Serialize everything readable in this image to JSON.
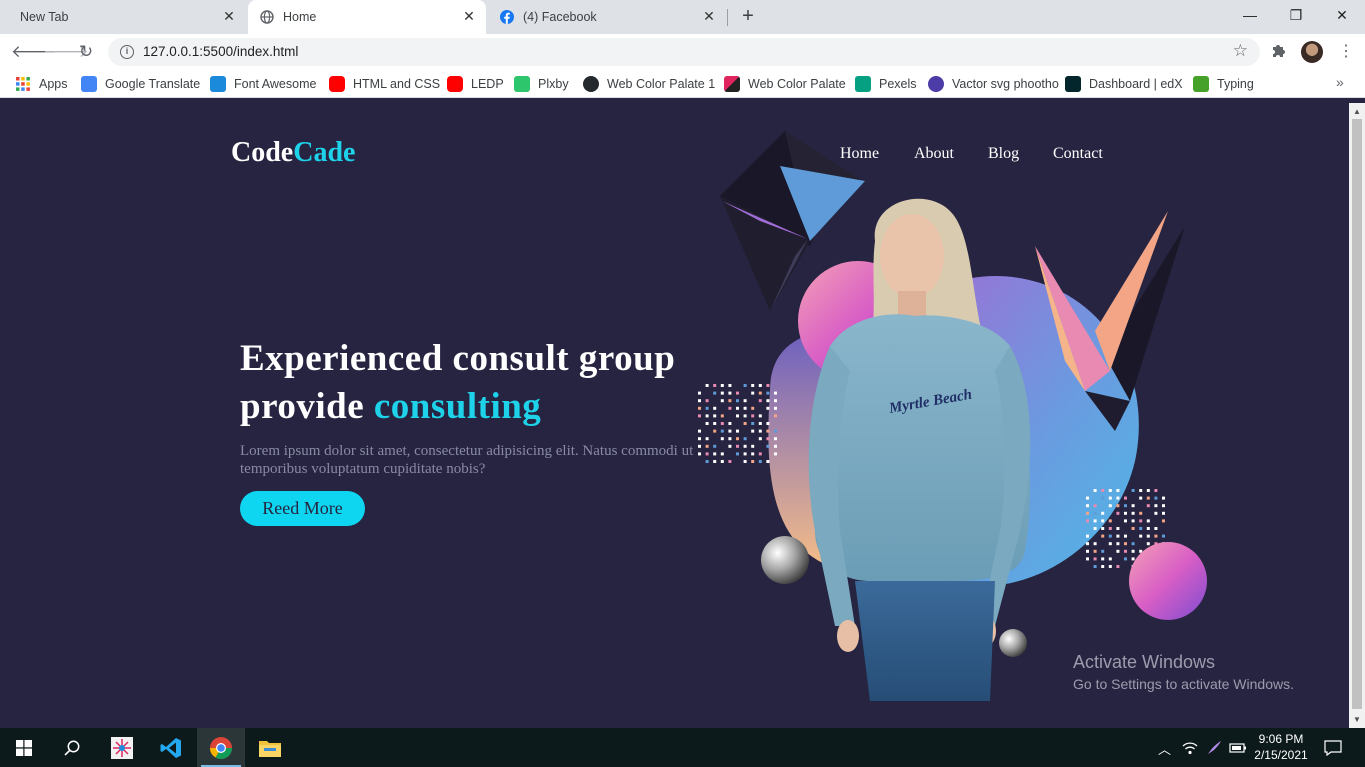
{
  "browser": {
    "tabs": [
      {
        "title": "New Tab",
        "active": false
      },
      {
        "title": "Home",
        "active": true
      },
      {
        "title": "(4) Facebook",
        "active": false
      }
    ],
    "url": "127.0.0.1:5500/index.html",
    "bookmarks": [
      {
        "label": "Apps",
        "icon": "apps-grid-icon",
        "color": "#ea4335"
      },
      {
        "label": "Google Translate",
        "icon": "google-translate-icon",
        "color": "#4285f4"
      },
      {
        "label": "Font Awesome",
        "icon": "font-awesome-flag-icon",
        "color": "#1c8adb"
      },
      {
        "label": "HTML and CSS",
        "icon": "youtube-icon",
        "color": "#ff0000"
      },
      {
        "label": "LEDP",
        "icon": "youtube-icon",
        "color": "#ff0000"
      },
      {
        "label": "Plxby",
        "icon": "pixabay-icon",
        "color": "#2ec66d"
      },
      {
        "label": "Web Color Palate 1",
        "icon": "github-icon",
        "color": "#24292e"
      },
      {
        "label": "Web Color Palate",
        "icon": "palette-icon",
        "color": "#e0245e"
      },
      {
        "label": "Pexels",
        "icon": "pexels-icon",
        "color": "#05a081"
      },
      {
        "label": "Vactor svg phootho",
        "icon": "vector-icon",
        "color": "#4b3ca7"
      },
      {
        "label": "Dashboard | edX",
        "icon": "edx-icon",
        "color": "#02262b"
      },
      {
        "label": "Typing",
        "icon": "typing-icon",
        "color": "#46a12a"
      }
    ]
  },
  "site": {
    "logo_main": "Code",
    "logo_accent": "Cade",
    "nav": [
      "Home",
      "About",
      "Blog",
      "Contact"
    ],
    "hero_line1": "Experienced consult group",
    "hero_line2_main": "provide ",
    "hero_line2_accent": "consulting",
    "hero_text": "Lorem ipsum dolor sit amet, consectetur adipisicing elit. Natus commodi ut temporibus voluptatum cupiditate nobis?",
    "cta_label": "Reed More",
    "shirt_text": "Myrtle Beach",
    "accent_color": "#1ed2ea",
    "background_color": "#262440"
  },
  "watermark": {
    "line1": "Activate Windows",
    "line2": "Go to Settings to activate Windows."
  },
  "taskbar": {
    "time": "9:06 PM",
    "date": "2/15/2021"
  }
}
